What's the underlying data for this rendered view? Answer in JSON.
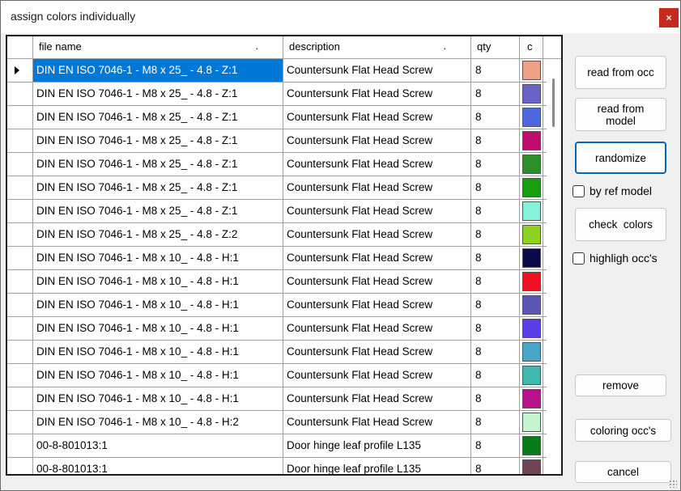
{
  "window": {
    "title": "assign colors individually",
    "close_label": "×"
  },
  "grid": {
    "columns": [
      {
        "key": "file",
        "label": "file name",
        "marker": "."
      },
      {
        "key": "desc",
        "label": "description",
        "marker": "."
      },
      {
        "key": "qty",
        "label": "qty",
        "marker": ""
      },
      {
        "key": "col",
        "label": "c",
        "marker": ""
      }
    ],
    "rows": [
      {
        "file": "DIN EN ISO 7046-1 - M8 x 25_ - 4.8 - Z:1",
        "desc": "Countersunk Flat Head Screw",
        "qty": "8",
        "color": "#ee9f88",
        "selected": true
      },
      {
        "file": "DIN EN ISO 7046-1 - M8 x 25_ - 4.8 - Z:1",
        "desc": "Countersunk Flat Head Screw",
        "qty": "8",
        "color": "#6a63c6"
      },
      {
        "file": "DIN EN ISO 7046-1 - M8 x 25_ - 4.8 - Z:1",
        "desc": "Countersunk Flat Head Screw",
        "qty": "8",
        "color": "#4d68e0"
      },
      {
        "file": "DIN EN ISO 7046-1 - M8 x 25_ - 4.8 - Z:1",
        "desc": "Countersunk Flat Head Screw",
        "qty": "8",
        "color": "#c00c6e"
      },
      {
        "file": "DIN EN ISO 7046-1 - M8 x 25_ - 4.8 - Z:1",
        "desc": "Countersunk Flat Head Screw",
        "qty": "8",
        "color": "#2a8f2a"
      },
      {
        "file": "DIN EN ISO 7046-1 - M8 x 25_ - 4.8 - Z:1",
        "desc": "Countersunk Flat Head Screw",
        "qty": "8",
        "color": "#169e0f"
      },
      {
        "file": "DIN EN ISO 7046-1 - M8 x 25_ - 4.8 - Z:1",
        "desc": "Countersunk Flat Head Screw",
        "qty": "8",
        "color": "#86f0d8"
      },
      {
        "file": "DIN EN ISO 7046-1 - M8 x 25_ - 4.8 - Z:2",
        "desc": "Countersunk Flat Head Screw",
        "qty": "8",
        "color": "#8ed31f"
      },
      {
        "file": "DIN EN ISO 7046-1 - M8 x 10_ - 4.8 - H:1",
        "desc": "Countersunk Flat Head Screw",
        "qty": "8",
        "color": "#0a0a4a"
      },
      {
        "file": "DIN EN ISO 7046-1 - M8 x 10_ - 4.8 - H:1",
        "desc": "Countersunk Flat Head Screw",
        "qty": "8",
        "color": "#f01024"
      },
      {
        "file": "DIN EN ISO 7046-1 - M8 x 10_ - 4.8 - H:1",
        "desc": "Countersunk Flat Head Screw",
        "qty": "8",
        "color": "#5b55b5"
      },
      {
        "file": "DIN EN ISO 7046-1 - M8 x 10_ - 4.8 - H:1",
        "desc": "Countersunk Flat Head Screw",
        "qty": "8",
        "color": "#5a3ce8"
      },
      {
        "file": "DIN EN ISO 7046-1 - M8 x 10_ - 4.8 - H:1",
        "desc": "Countersunk Flat Head Screw",
        "qty": "8",
        "color": "#4aa6c8"
      },
      {
        "file": "DIN EN ISO 7046-1 - M8 x 10_ - 4.8 - H:1",
        "desc": "Countersunk Flat Head Screw",
        "qty": "8",
        "color": "#3fb8b0"
      },
      {
        "file": "DIN EN ISO 7046-1 - M8 x 10_ - 4.8 - H:1",
        "desc": "Countersunk Flat Head Screw",
        "qty": "8",
        "color": "#b8128a"
      },
      {
        "file": "DIN EN ISO 7046-1 - M8 x 10_ - 4.8 - H:2",
        "desc": "Countersunk Flat Head Screw",
        "qty": "8",
        "color": "#c4f5d0"
      },
      {
        "file": "00-8-801013:1",
        "desc": "Door hinge leaf profile L135",
        "qty": "8",
        "color": "#0a7a1a"
      },
      {
        "file": "00-8-801013:1",
        "desc": "Door hinge leaf profile L135",
        "qty": "8",
        "color": "#6e4456"
      }
    ]
  },
  "buttons": {
    "read_from_occ": "read from occ",
    "read_from_model": "read from model",
    "randomize": "randomize",
    "check_colors": "check  colors",
    "remove": "remove",
    "coloring_occs": "coloring occ's",
    "cancel": "cancel"
  },
  "checkboxes": {
    "by_ref_model": {
      "label": "by ref  model",
      "checked": false
    },
    "highlight_occs": {
      "label": "highligh occ's",
      "checked": false
    }
  }
}
